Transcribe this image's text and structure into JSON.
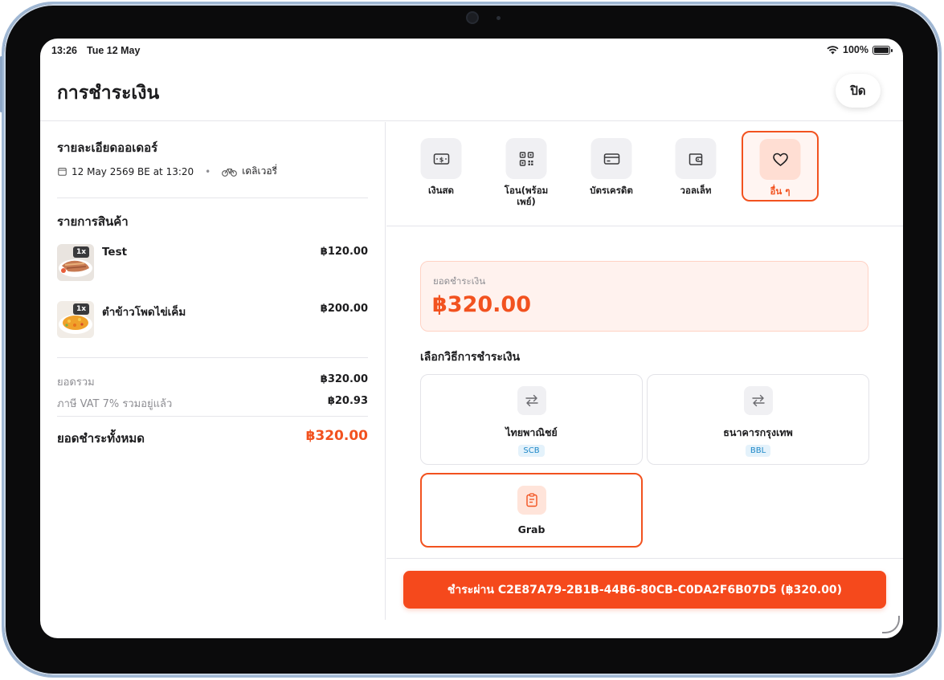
{
  "status_bar": {
    "time": "13:26",
    "date": "Tue 12 May",
    "battery": "100%"
  },
  "header": {
    "title": "การชำระเงิน",
    "close_label": "ปิด"
  },
  "order": {
    "section_title": "รายละเอียดออเดอร์",
    "datetime": "12 May 2569 BE at 13:20",
    "separator": "•",
    "order_type": "เดลิเวอรี่",
    "items_title": "รายการสินค้า",
    "items": [
      {
        "qty": "1x",
        "name": "Test",
        "price": "฿120.00"
      },
      {
        "qty": "1x",
        "name": "ตำข้าวโพดไข่เค็ม",
        "price": "฿200.00"
      }
    ],
    "subtotal_label": "ยอดรวม",
    "subtotal_value": "฿320.00",
    "vat_label": "ภาษี VAT 7% รวมอยู่แล้ว",
    "vat_value": "฿20.93",
    "total_label": "ยอดชำระทั้งหมด",
    "total_value": "฿320.00"
  },
  "payment_methods": [
    {
      "label": "เงินสด",
      "icon": "cash-icon"
    },
    {
      "label": "โอน(พร้อมเพย์)",
      "icon": "qr-code-icon"
    },
    {
      "label": "บัตรเครดิต",
      "icon": "credit-card-icon"
    },
    {
      "label": "วอลเล็ท",
      "icon": "wallet-icon"
    },
    {
      "label": "อื่น ๆ",
      "icon": "heart-icon",
      "active": true
    }
  ],
  "amount": {
    "label": "ยอดชำระเงิน",
    "value": "฿320.00"
  },
  "choose_title": "เลือกวิธีการชำระเงิน",
  "options": [
    {
      "name": "ไทยพาณิชย์",
      "code": "SCB",
      "icon": "transfer-arrows-icon"
    },
    {
      "name": "ธนาคารกรุงเทพ",
      "code": "BBL",
      "icon": "transfer-arrows-icon"
    },
    {
      "name": "Grab",
      "icon": "clipboard-icon",
      "selected": true
    }
  ],
  "pay_button_label": "ชำระผ่าน C2E87A79-2B1B-44B6-80CB-C0DA2F6B07D5 (฿320.00)",
  "colors": {
    "accent": "#f5491c",
    "accent_light": "#fff2ee",
    "code_badge": "#1e88c8",
    "frame": "#9fb7d4"
  }
}
